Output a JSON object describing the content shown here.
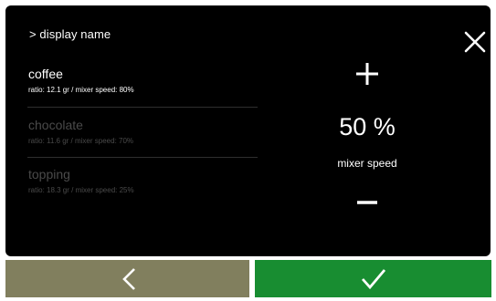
{
  "header": {
    "breadcrumb": "> display name",
    "close_icon": "close-icon"
  },
  "products": [
    {
      "name": "coffee",
      "detail": "ratio: 12.1 gr / mixer speed: 80%",
      "state": "selected"
    },
    {
      "name": "chocolate",
      "detail": "ratio: 11.6 gr / mixer speed: 70%",
      "state": "unselected"
    },
    {
      "name": "topping",
      "detail": "ratio: 18.3 gr / mixer speed: 25%",
      "state": "unselected"
    }
  ],
  "adjuster": {
    "value": "50 %",
    "label": "mixer speed",
    "increase_icon": "plus-icon",
    "decrease_icon": "minus-icon"
  },
  "footer": {
    "back_icon": "chevron-left-icon",
    "confirm_icon": "checkmark-icon",
    "back_color": "#817f5e",
    "confirm_color": "#188d31"
  }
}
